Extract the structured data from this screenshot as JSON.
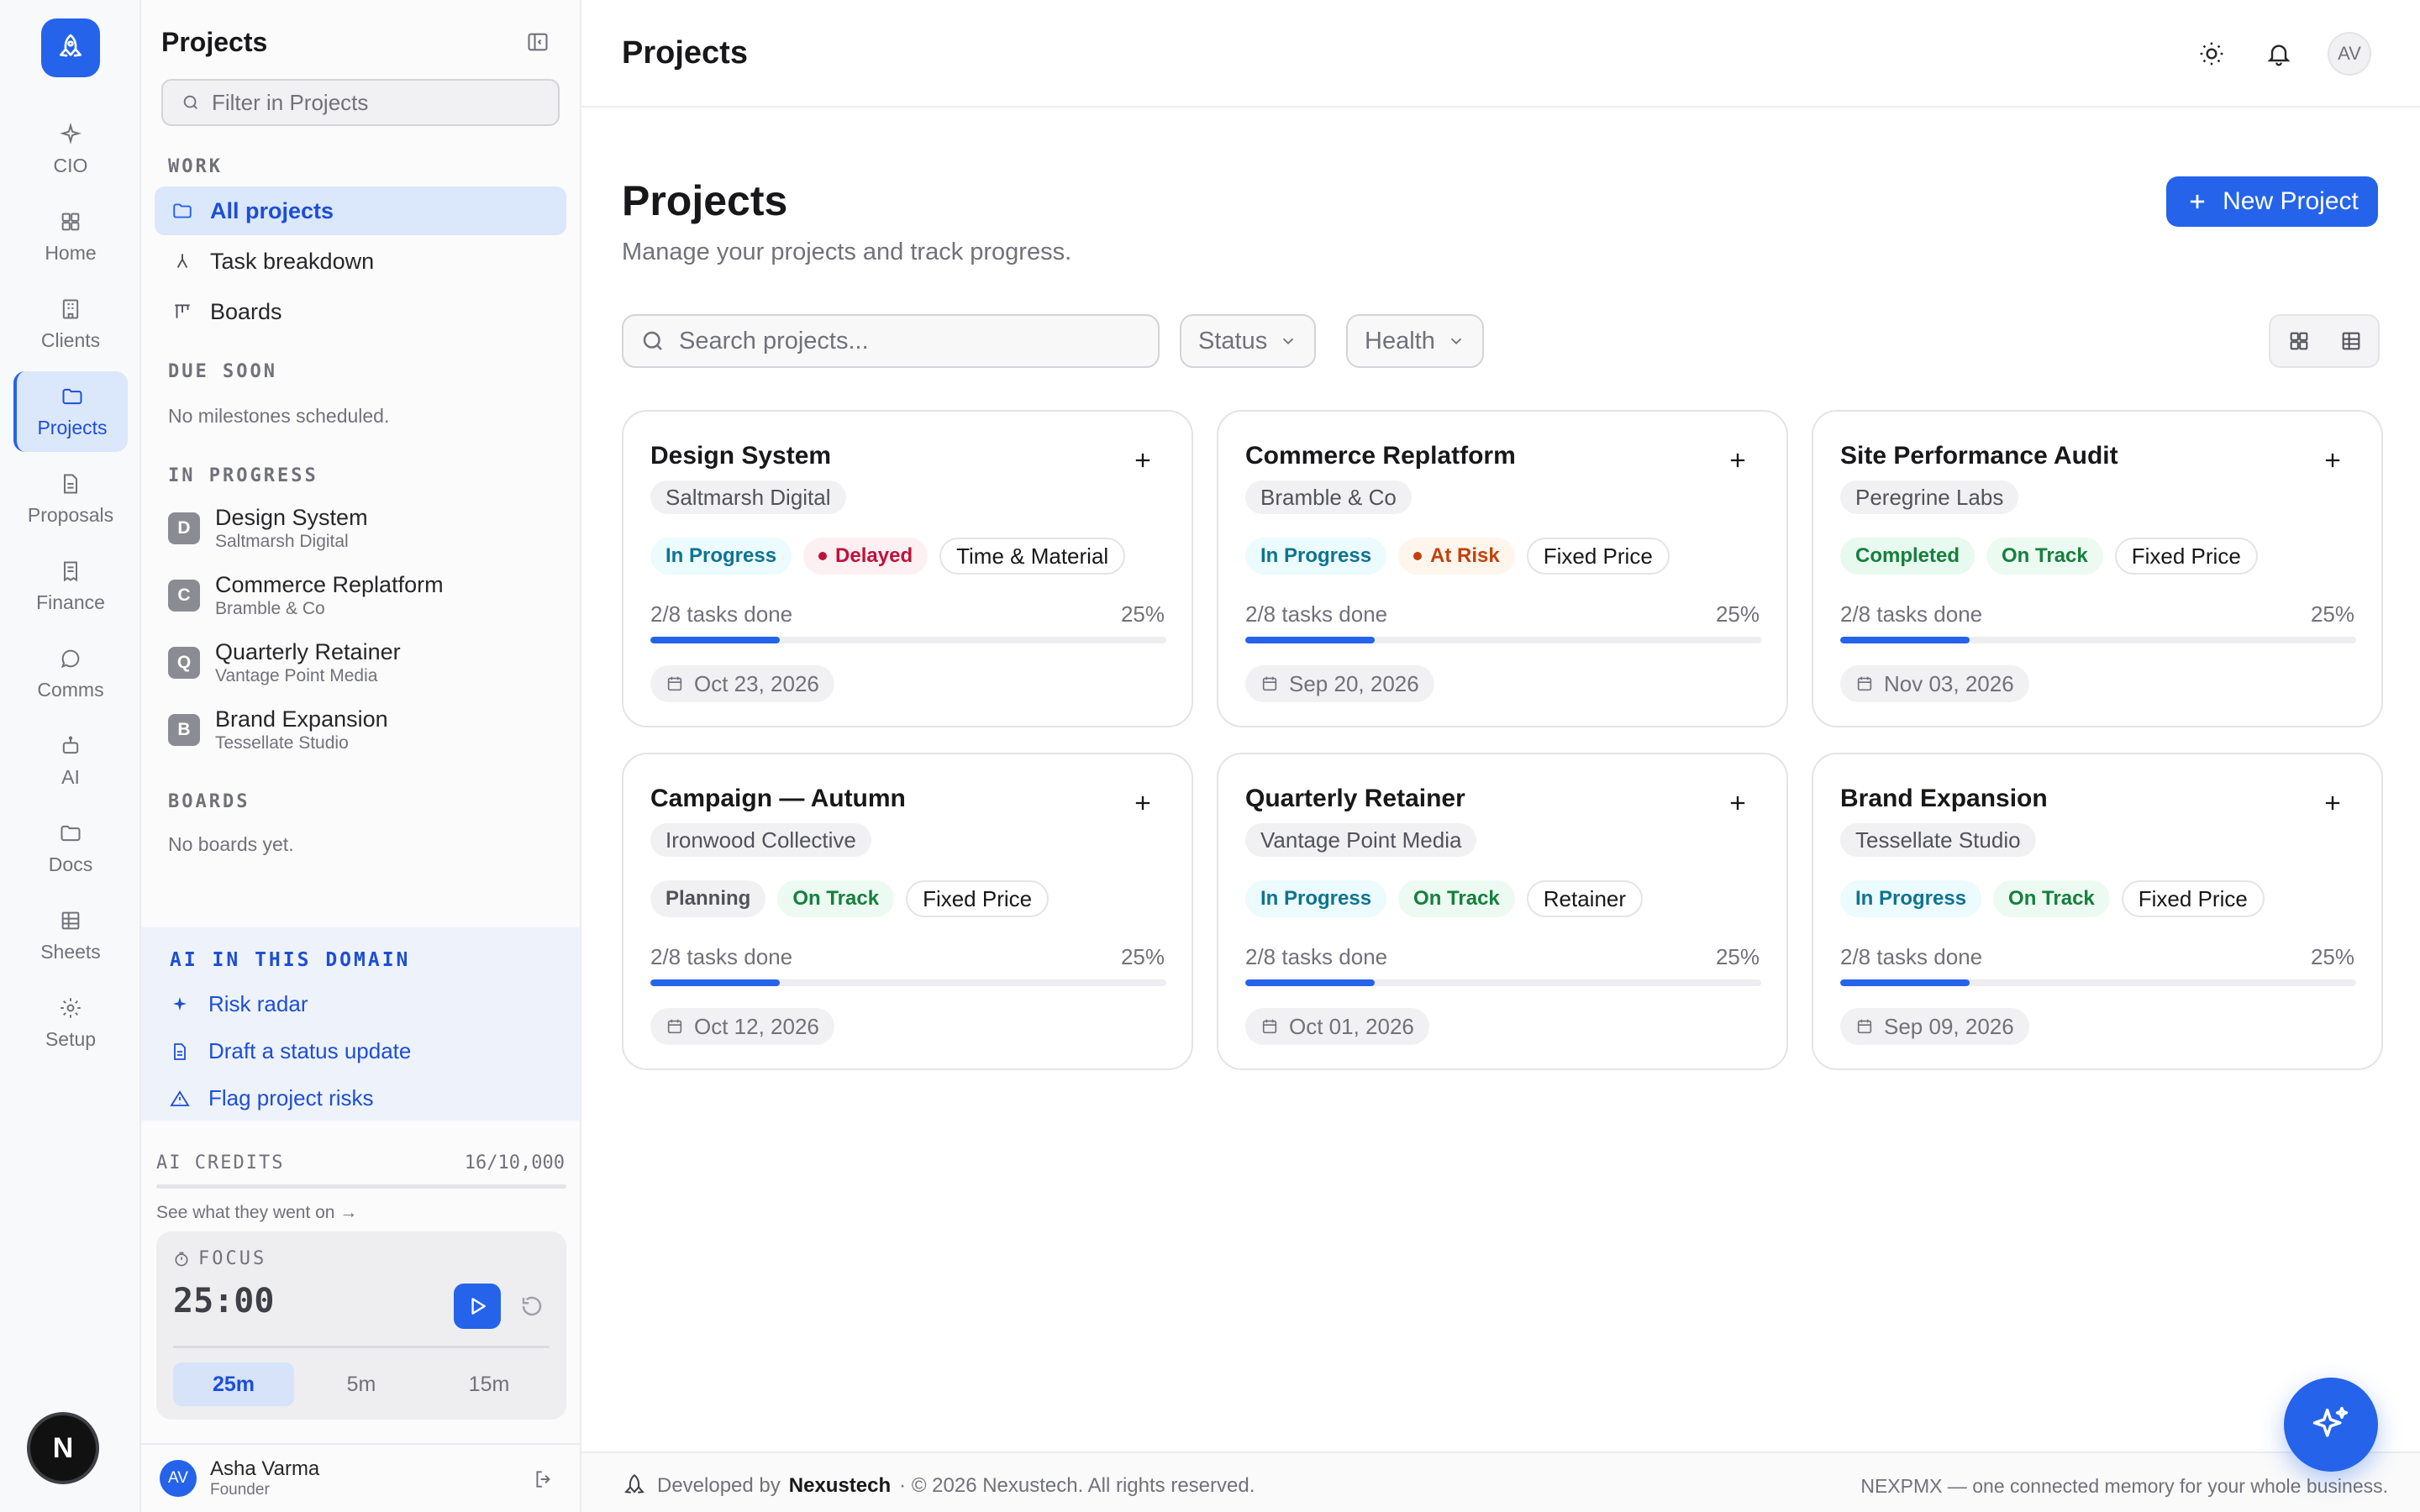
{
  "rail": {
    "items": [
      {
        "label": "CIO",
        "icon": "sparkle-icon"
      },
      {
        "label": "Home",
        "icon": "grid-icon"
      },
      {
        "label": "Clients",
        "icon": "building-icon"
      },
      {
        "label": "Projects",
        "icon": "folder-icon",
        "active": true
      },
      {
        "label": "Proposals",
        "icon": "document-icon"
      },
      {
        "label": "Finance",
        "icon": "receipt-icon"
      },
      {
        "label": "Comms",
        "icon": "chat-icon"
      },
      {
        "label": "AI",
        "icon": "robot-icon"
      },
      {
        "label": "Docs",
        "icon": "folder-icon"
      },
      {
        "label": "Sheets",
        "icon": "table-icon"
      },
      {
        "label": "Setup",
        "icon": "gear-icon"
      }
    ],
    "bottom_badge": "N"
  },
  "sidebar": {
    "title": "Projects",
    "filter_placeholder": "Filter in Projects",
    "sections": {
      "work": "WORK",
      "due_soon": "DUE SOON",
      "in_progress": "IN PROGRESS",
      "boards": "BOARDS"
    },
    "work_links": [
      {
        "label": "All projects",
        "active": true
      },
      {
        "label": "Task breakdown"
      },
      {
        "label": "Boards"
      }
    ],
    "due_soon_empty": "No milestones scheduled.",
    "in_progress": [
      {
        "initial": "D",
        "name": "Design System",
        "client": "Saltmarsh Digital"
      },
      {
        "initial": "C",
        "name": "Commerce Replatform",
        "client": "Bramble & Co"
      },
      {
        "initial": "Q",
        "name": "Quarterly Retainer",
        "client": "Vantage Point Media"
      },
      {
        "initial": "B",
        "name": "Brand Expansion",
        "client": "Tessellate Studio"
      }
    ],
    "boards_empty": "No boards yet.",
    "ai": {
      "heading": "AI IN THIS DOMAIN",
      "links": [
        "Risk radar",
        "Draft a status update",
        "Flag project risks"
      ]
    },
    "credits": {
      "label": "AI CREDITS",
      "value": "16/10,000",
      "used_fraction": 0.0016,
      "link": "See what they went on →"
    },
    "focus": {
      "label": "FOCUS",
      "time": "25:00",
      "options": [
        "25m",
        "5m",
        "15m"
      ],
      "selected": "25m"
    },
    "user": {
      "initials": "AV",
      "name": "Asha Varma",
      "role": "Founder"
    }
  },
  "topbar": {
    "title": "Projects",
    "avatar": "AV"
  },
  "main": {
    "title": "Projects",
    "subtitle": "Manage your projects and track progress.",
    "new_button": "New Project",
    "search_placeholder": "Search projects...",
    "filters": [
      "Status",
      "Health"
    ],
    "view": "grid"
  },
  "projects": [
    {
      "name": "Design System",
      "client": "Saltmarsh Digital",
      "status": "In Progress",
      "status_class": "inprogress",
      "health": "Delayed",
      "health_class": "delayed",
      "health_dot": true,
      "billing": "Time & Material",
      "tasks": "2/8 tasks done",
      "percent": "25%",
      "progress": 0.25,
      "date": "Oct 23, 2026"
    },
    {
      "name": "Commerce Replatform",
      "client": "Bramble & Co",
      "status": "In Progress",
      "status_class": "inprogress",
      "health": "At Risk",
      "health_class": "atrisk",
      "health_dot": true,
      "billing": "Fixed Price",
      "tasks": "2/8 tasks done",
      "percent": "25%",
      "progress": 0.25,
      "date": "Sep 20, 2026"
    },
    {
      "name": "Site Performance Audit",
      "client": "Peregrine Labs",
      "status": "Completed",
      "status_class": "completed",
      "health": "On Track",
      "health_class": "ontrack",
      "health_dot": false,
      "billing": "Fixed Price",
      "tasks": "2/8 tasks done",
      "percent": "25%",
      "progress": 0.25,
      "date": "Nov 03, 2026"
    },
    {
      "name": "Campaign — Autumn",
      "client": "Ironwood Collective",
      "status": "Planning",
      "status_class": "planning",
      "health": "On Track",
      "health_class": "ontrack",
      "health_dot": false,
      "billing": "Fixed Price",
      "tasks": "2/8 tasks done",
      "percent": "25%",
      "progress": 0.25,
      "date": "Oct 12, 2026"
    },
    {
      "name": "Quarterly Retainer",
      "client": "Vantage Point Media",
      "status": "In Progress",
      "status_class": "inprogress",
      "health": "On Track",
      "health_class": "ontrack",
      "health_dot": false,
      "billing": "Retainer",
      "tasks": "2/8 tasks done",
      "percent": "25%",
      "progress": 0.25,
      "date": "Oct 01, 2026"
    },
    {
      "name": "Brand Expansion",
      "client": "Tessellate Studio",
      "status": "In Progress",
      "status_class": "inprogress",
      "health": "On Track",
      "health_class": "ontrack",
      "health_dot": false,
      "billing": "Fixed Price",
      "tasks": "2/8 tasks done",
      "percent": "25%",
      "progress": 0.25,
      "date": "Sep 09, 2026"
    }
  ],
  "footer": {
    "developed_by": "Developed by",
    "company": "Nexustech",
    "copyright": "· © 2026 Nexustech. All rights reserved.",
    "tagline": "NEXPMX — one connected memory for your whole business."
  },
  "colors": {
    "accent": "#2563eb",
    "in_progress": "#0e7490",
    "delayed": "#be123c",
    "at_risk": "#c2410c",
    "on_track": "#15803d"
  }
}
